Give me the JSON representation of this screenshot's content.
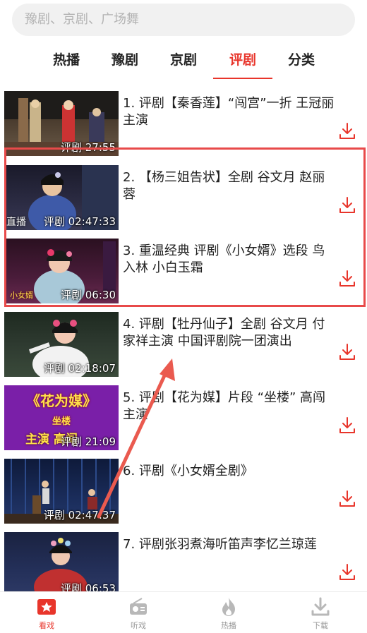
{
  "search": {
    "placeholder": "豫剧、京剧、广场舞"
  },
  "tabs": [
    {
      "label": "热播",
      "active": false
    },
    {
      "label": "豫剧",
      "active": false
    },
    {
      "label": "京剧",
      "active": false
    },
    {
      "label": "评剧",
      "active": true
    },
    {
      "label": "分类",
      "active": false
    }
  ],
  "items": [
    {
      "title": "1. 评剧【秦香莲】“闯宫”一折 王冠丽主演",
      "duration": "评剧 27:55"
    },
    {
      "title": "2. 【杨三姐告状】全剧 谷文月 赵丽蓉",
      "duration": "评剧 02:47:33",
      "thumb_text": "直播"
    },
    {
      "title": "3. 重温经典 评剧《小女婿》选段 鸟入林 小白玉霜",
      "duration": "评剧 06:30",
      "thumb_text": "小女婿"
    },
    {
      "title": "4. 评剧【牡丹仙子】全剧 谷文月 付家祥主演 中国评剧院一团演出",
      "duration": "评剧 02:18:07"
    },
    {
      "title": "5. 评剧【花为媒】片段 “坐楼” 高闯主演",
      "duration": "评剧 21:09",
      "thumb_text": "《花为媒》",
      "thumb_sub": "坐楼",
      "thumb_credit": "主演 高闯"
    },
    {
      "title": "6. 评剧《小女婿全剧》",
      "duration": "评剧 02:47:37"
    },
    {
      "title": "7. 评剧张羽煮海听笛声李忆兰琼莲",
      "duration": "评剧 06:53"
    }
  ],
  "bottom_nav": [
    {
      "label": "看戏",
      "icon": "theater-star-icon",
      "active": true
    },
    {
      "label": "听戏",
      "icon": "radio-icon",
      "active": false
    },
    {
      "label": "热播",
      "icon": "fire-icon",
      "active": false
    },
    {
      "label": "下载",
      "icon": "download-tray-icon",
      "active": false
    }
  ],
  "colors": {
    "accent": "#e8352b",
    "highlight_box": "#e84a4a",
    "arrow": "#ea5a4f"
  }
}
